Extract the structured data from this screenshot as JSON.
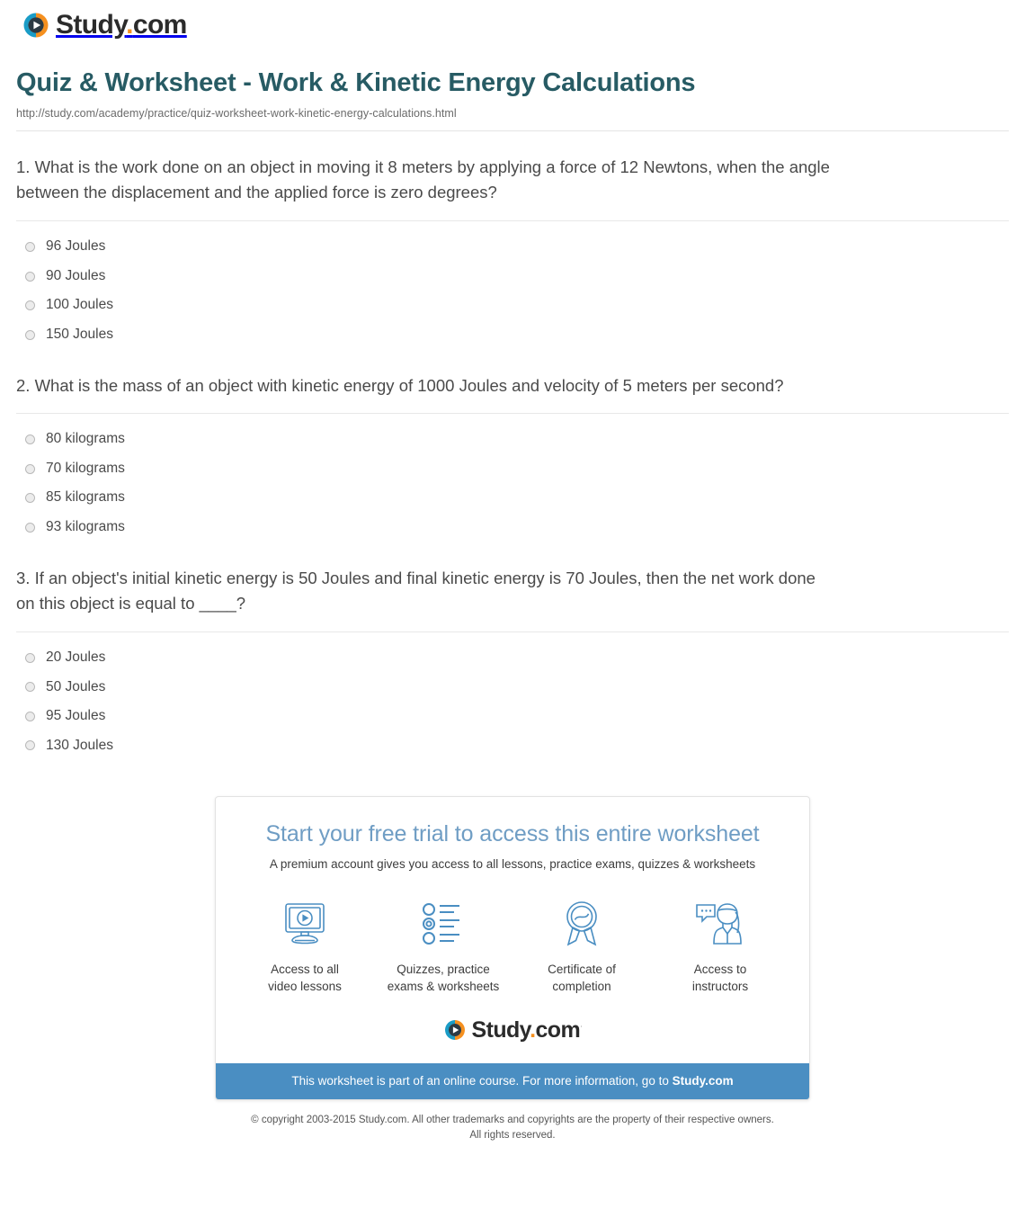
{
  "brand": {
    "name_main": "Study",
    "name_dot": ".",
    "name_tld": "com",
    "trademark": "·",
    "logo_icon": "play-circle-icon",
    "colors": {
      "teal": "#1a9cc6",
      "orange": "#f5901f",
      "dark": "#2b2b2b"
    }
  },
  "header": {
    "title": "Quiz & Worksheet - Work & Kinetic Energy Calculations",
    "url": "http://study.com/academy/practice/quiz-worksheet-work-kinetic-energy-calculations.html",
    "title_color": "#275b64"
  },
  "quiz": {
    "questions": [
      {
        "number": "1.",
        "text": "1. What is the work done on an object in moving it 8 meters by applying a force of 12 Newtons, when the angle between the displacement and the applied force is zero degrees?",
        "options": [
          "96 Joules",
          "90 Joules",
          "100 Joules",
          "150 Joules"
        ]
      },
      {
        "number": "2.",
        "text": "2. What is the mass of an object with kinetic energy of 1000 Joules and velocity of 5 meters per second?",
        "options": [
          "80 kilograms",
          "70 kilograms",
          "85 kilograms",
          "93 kilograms"
        ]
      },
      {
        "number": "3.",
        "text": "3. If an object's initial kinetic energy is 50 Joules and final kinetic energy is 70 Joules, then the net work done on this object is equal to ____?",
        "options": [
          "20 Joules",
          "50 Joules",
          "95 Joules",
          "130 Joules"
        ]
      }
    ]
  },
  "promo": {
    "title": "Start your free trial to access this entire worksheet",
    "subtitle": "A premium account gives you access to all lessons, practice exams, quizzes & worksheets",
    "title_color": "#6f9dc4",
    "bar_color": "#4a8ec2",
    "features": [
      {
        "icon": "monitor-play-icon",
        "label_line1": "Access to all",
        "label_line2": "video lessons"
      },
      {
        "icon": "quiz-list-icon",
        "label_line1": "Quizzes, practice",
        "label_line2": "exams & worksheets"
      },
      {
        "icon": "award-ribbon-icon",
        "label_line1": "Certificate of",
        "label_line2": "completion"
      },
      {
        "icon": "instructor-chat-icon",
        "label_line1": "Access to",
        "label_line2": "instructors"
      }
    ],
    "bar_text_lead": "This worksheet is part of an online course. For more information, go to ",
    "bar_text_brand": "Study.com"
  },
  "footer": {
    "copyright_line1": "© copyright 2003-2015 Study.com. All other trademarks and copyrights are the property of their respective owners.",
    "copyright_line2": "All rights reserved."
  }
}
